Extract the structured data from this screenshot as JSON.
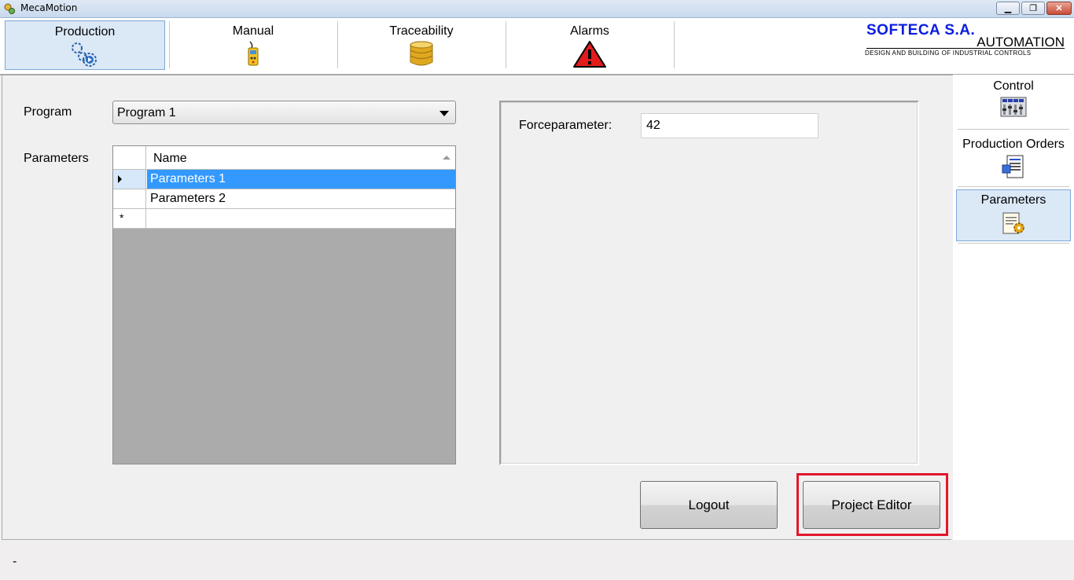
{
  "window": {
    "title": "MecaMotion"
  },
  "nav": {
    "tabs": [
      {
        "label": "Production",
        "icon": "gears-play-icon",
        "active": true
      },
      {
        "label": "Manual",
        "icon": "remote-control-icon",
        "active": false
      },
      {
        "label": "Traceability",
        "icon": "database-icon",
        "active": false
      },
      {
        "label": "Alarms",
        "icon": "warning-triangle-icon",
        "active": false
      }
    ]
  },
  "logo": {
    "main": "SOFTECA S.A.",
    "automation": "AUTOMATION",
    "subtitle": "DESIGN AND BUILDING OF INDUSTRIAL CONTROLS"
  },
  "form": {
    "program_label": "Program",
    "program_value": "Program 1",
    "parameters_label": "Parameters"
  },
  "grid": {
    "column": "Name",
    "rows": [
      "Parameters 1",
      "Parameters 2"
    ],
    "new_row_marker": "*"
  },
  "details": {
    "force_label": "Forceparameter:",
    "force_value": "42"
  },
  "buttons": {
    "logout": "Logout",
    "project_editor": "Project Editor"
  },
  "sidebar": {
    "items": [
      {
        "label": "Control",
        "icon": "control-panel-icon",
        "active": false
      },
      {
        "label": "Production Orders",
        "icon": "order-document-icon",
        "active": false
      },
      {
        "label": "Parameters",
        "icon": "parameters-document-icon",
        "active": true
      }
    ]
  },
  "status": {
    "text": "-"
  },
  "colors": {
    "accent": "#3399ff",
    "highlight": "#e3162b",
    "logo_blue": "#0a1de0"
  }
}
